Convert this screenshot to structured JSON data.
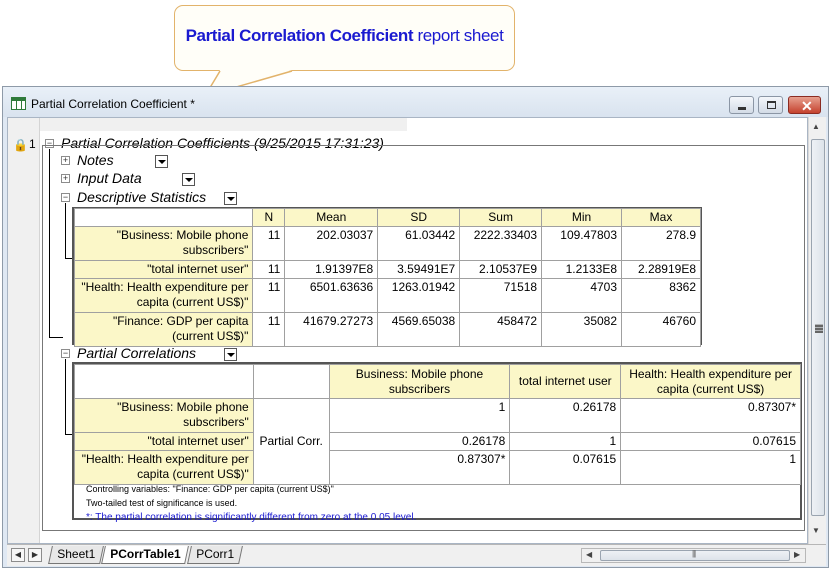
{
  "callout": {
    "bold_text": "Partial Correlation Coefficient",
    "normal_text": "report sheet"
  },
  "window": {
    "title": "Partial Correlation Coefficient *"
  },
  "report": {
    "row_number": "1",
    "main_title": "Partial Correlation Coefficients (9/25/2015 17:31:23)",
    "sections": {
      "notes": "Notes",
      "input_data": "Input Data",
      "descriptive": "Descriptive Statistics",
      "partial": "Partial Correlations"
    }
  },
  "descriptive_table": {
    "headers": [
      "N",
      "Mean",
      "SD",
      "Sum",
      "Min",
      "Max"
    ],
    "rows": [
      {
        "label": "\"Business: Mobile phone subscribers\"",
        "values": [
          "11",
          "202.03037",
          "61.03442",
          "2222.33403",
          "109.47803",
          "278.9"
        ]
      },
      {
        "label": "\"total internet user\"",
        "values": [
          "11",
          "1.91397E8",
          "3.59491E7",
          "2.10537E9",
          "1.2133E8",
          "2.28919E8"
        ]
      },
      {
        "label": "\"Health: Health expenditure per capita (current US$)\"",
        "values": [
          "11",
          "6501.63636",
          "1263.01942",
          "71518",
          "4703",
          "8362"
        ]
      },
      {
        "label": "\"Finance: GDP per capita (current US$)\"",
        "values": [
          "11",
          "41679.27273",
          "4569.65038",
          "458472",
          "35082",
          "46760"
        ]
      }
    ]
  },
  "partial_table": {
    "headers": [
      "Business: Mobile phone subscribers",
      "total internet user",
      "Health: Health expenditure per capita (current US$)"
    ],
    "stat_label": "Partial Corr.",
    "rows": [
      {
        "label": "\"Business: Mobile phone subscribers\"",
        "values": [
          "1",
          "0.26178",
          "0.87307*"
        ]
      },
      {
        "label": "\"total internet user\"",
        "values": [
          "0.26178",
          "1",
          "0.07615"
        ]
      },
      {
        "label": "\"Health: Health expenditure per capita (current US$)\"",
        "values": [
          "0.87307*",
          "0.07615",
          "1"
        ]
      }
    ],
    "notes": [
      "Controlling variables: \"Finance: GDP per capita (current US$)\"",
      "Two-tailed test of significance is used."
    ],
    "significance_note": "*: The partial correlation is significantly different from zero at the 0.05 level."
  },
  "sheet_tabs": [
    "Sheet1",
    "PCorrTable1",
    "PCorr1"
  ],
  "active_tab": "PCorrTable1",
  "colors": {
    "callout_border": "#e2b36b",
    "callout_text": "#1a1ad0",
    "header_fill": "#fbf7c8",
    "close_button": "#c5422e"
  }
}
